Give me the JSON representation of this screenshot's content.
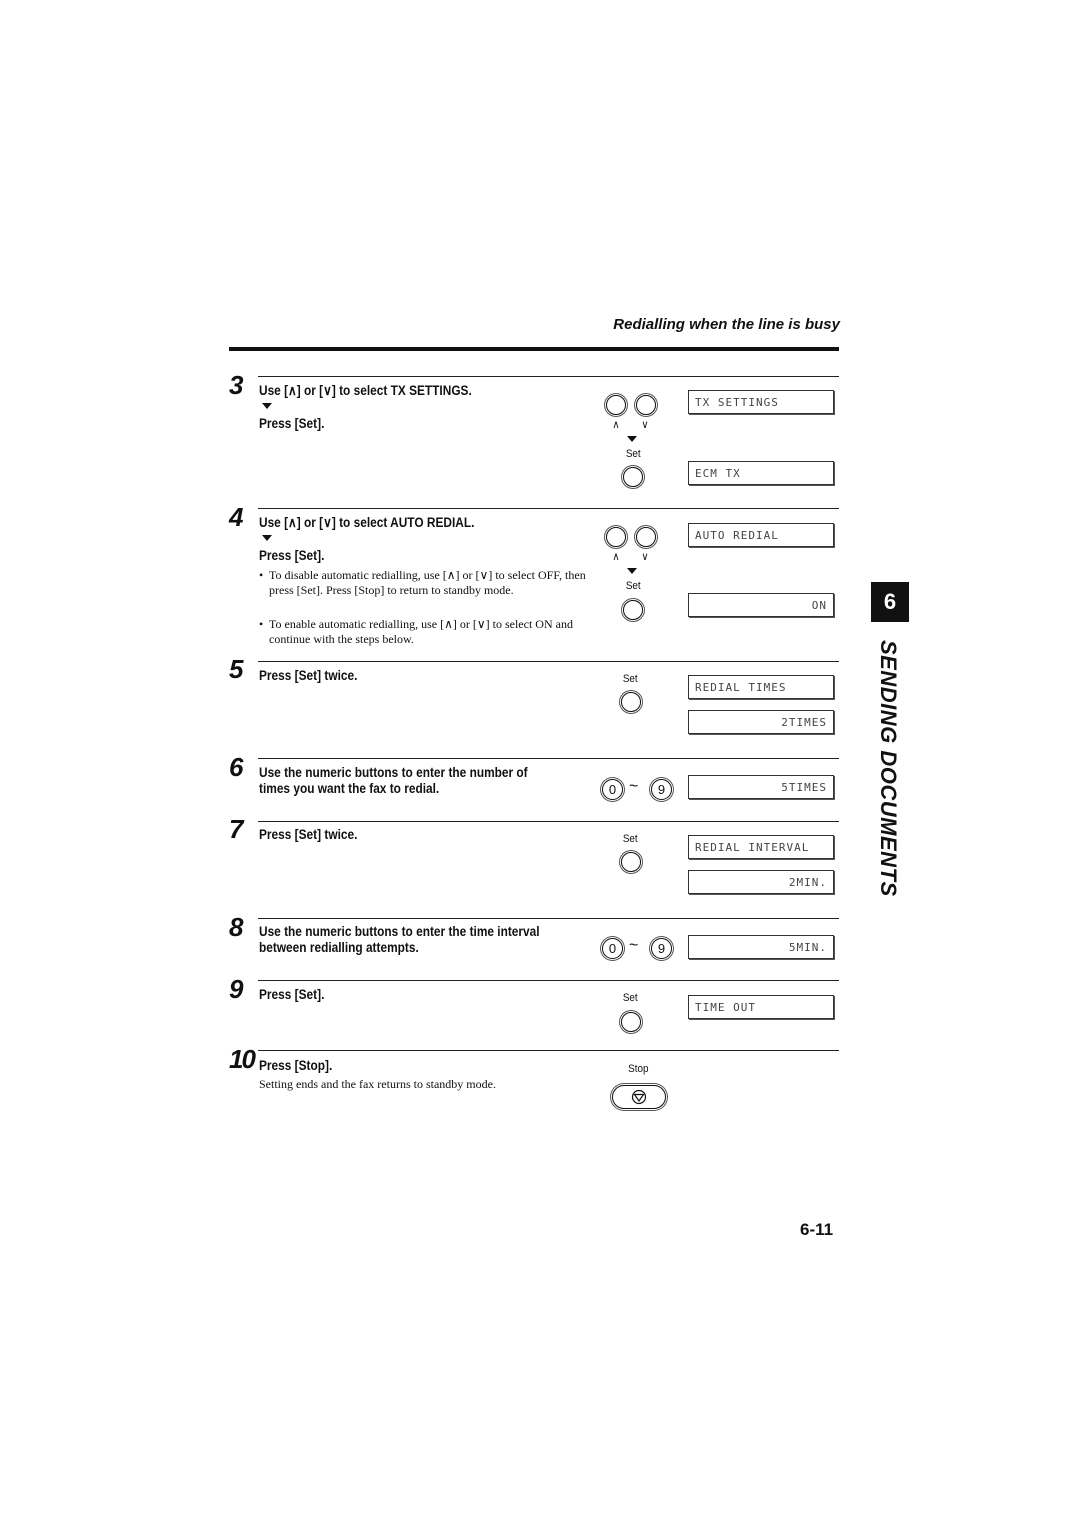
{
  "header": {
    "section_title": "Redialling when the line is busy"
  },
  "chapter": {
    "number": "6",
    "title": "SENDING DOCUMENTS"
  },
  "page_number": "6-11",
  "icons": {
    "up_arrow": "∧",
    "down_arrow": "∨",
    "tilde": "~"
  },
  "steps": [
    {
      "number": "3",
      "line1": "Use [∧] or [∨] to select TX SETTINGS.",
      "line2": "Press [Set].",
      "set_label": "Set",
      "displays": [
        "TX SETTINGS",
        "ECM TX"
      ]
    },
    {
      "number": "4",
      "line1": "Use [∧] or [∨] to select AUTO REDIAL.",
      "line2": "Press [Set].",
      "set_label": "Set",
      "bullets": [
        "To disable automatic redialling, use [∧] or [∨] to select OFF, then press [Set]. Press [Stop] to return to standby mode.",
        "To enable automatic redialling, use [∧] or [∨] to select ON and continue with the steps below."
      ],
      "displays": [
        "AUTO REDIAL",
        "ON"
      ]
    },
    {
      "number": "5",
      "line1": "Press [Set] twice.",
      "set_label": "Set",
      "displays": [
        "REDIAL TIMES",
        "2TIMES"
      ]
    },
    {
      "number": "6",
      "line1": "Use the numeric buttons to enter the number of",
      "line2": "times you want the fax to redial.",
      "keys": [
        "0",
        "9"
      ],
      "displays": [
        "5TIMES"
      ]
    },
    {
      "number": "7",
      "line1": "Press [Set] twice.",
      "set_label": "Set",
      "displays": [
        "REDIAL INTERVAL",
        "2MIN."
      ]
    },
    {
      "number": "8",
      "line1": "Use the numeric buttons to enter the time interval",
      "line2": "between redialling attempts.",
      "keys": [
        "0",
        "9"
      ],
      "displays": [
        "5MIN."
      ]
    },
    {
      "number": "9",
      "line1": "Press [Set].",
      "set_label": "Set",
      "displays": [
        "TIME OUT"
      ]
    },
    {
      "number": "10",
      "line1": "Press [Stop].",
      "note": "Setting ends and the fax returns to standby mode.",
      "stop_label": "Stop"
    }
  ]
}
